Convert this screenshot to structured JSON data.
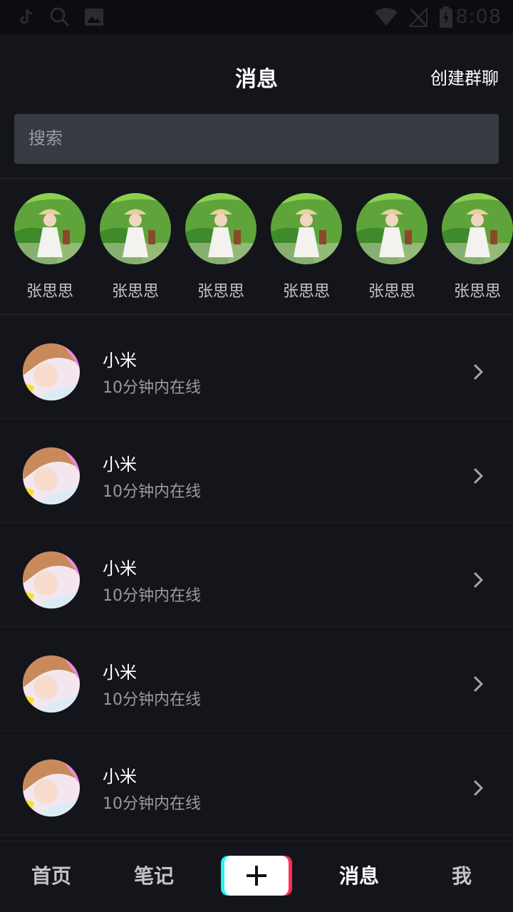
{
  "status_bar": {
    "time": "8:08",
    "left_icons": [
      "tiktok-icon",
      "search-icon",
      "image-icon"
    ],
    "right_icons": [
      "wifi-icon",
      "no-signal-icon",
      "battery-charging-icon"
    ]
  },
  "header": {
    "title": "消息",
    "action_label": "创建群聊"
  },
  "search": {
    "placeholder": "搜索"
  },
  "friends": [
    {
      "name": "张思思"
    },
    {
      "name": "张思思"
    },
    {
      "name": "张思思"
    },
    {
      "name": "张思思"
    },
    {
      "name": "张思思"
    },
    {
      "name": "张思思"
    }
  ],
  "contacts": [
    {
      "name": "小米",
      "status": "10分钟内在线"
    },
    {
      "name": "小米",
      "status": "10分钟内在线"
    },
    {
      "name": "小米",
      "status": "10分钟内在线"
    },
    {
      "name": "小米",
      "status": "10分钟内在线"
    },
    {
      "name": "小米",
      "status": "10分钟内在线"
    }
  ],
  "bottom_nav": {
    "home": "首页",
    "notes": "笔记",
    "create_icon": "plus-icon",
    "messages": "消息",
    "me": "我",
    "active": "messages"
  },
  "colors": {
    "background": "#14151b",
    "search_bg": "#383a41",
    "accent_cyan": "#25f4ee",
    "accent_red": "#fe2c55"
  }
}
